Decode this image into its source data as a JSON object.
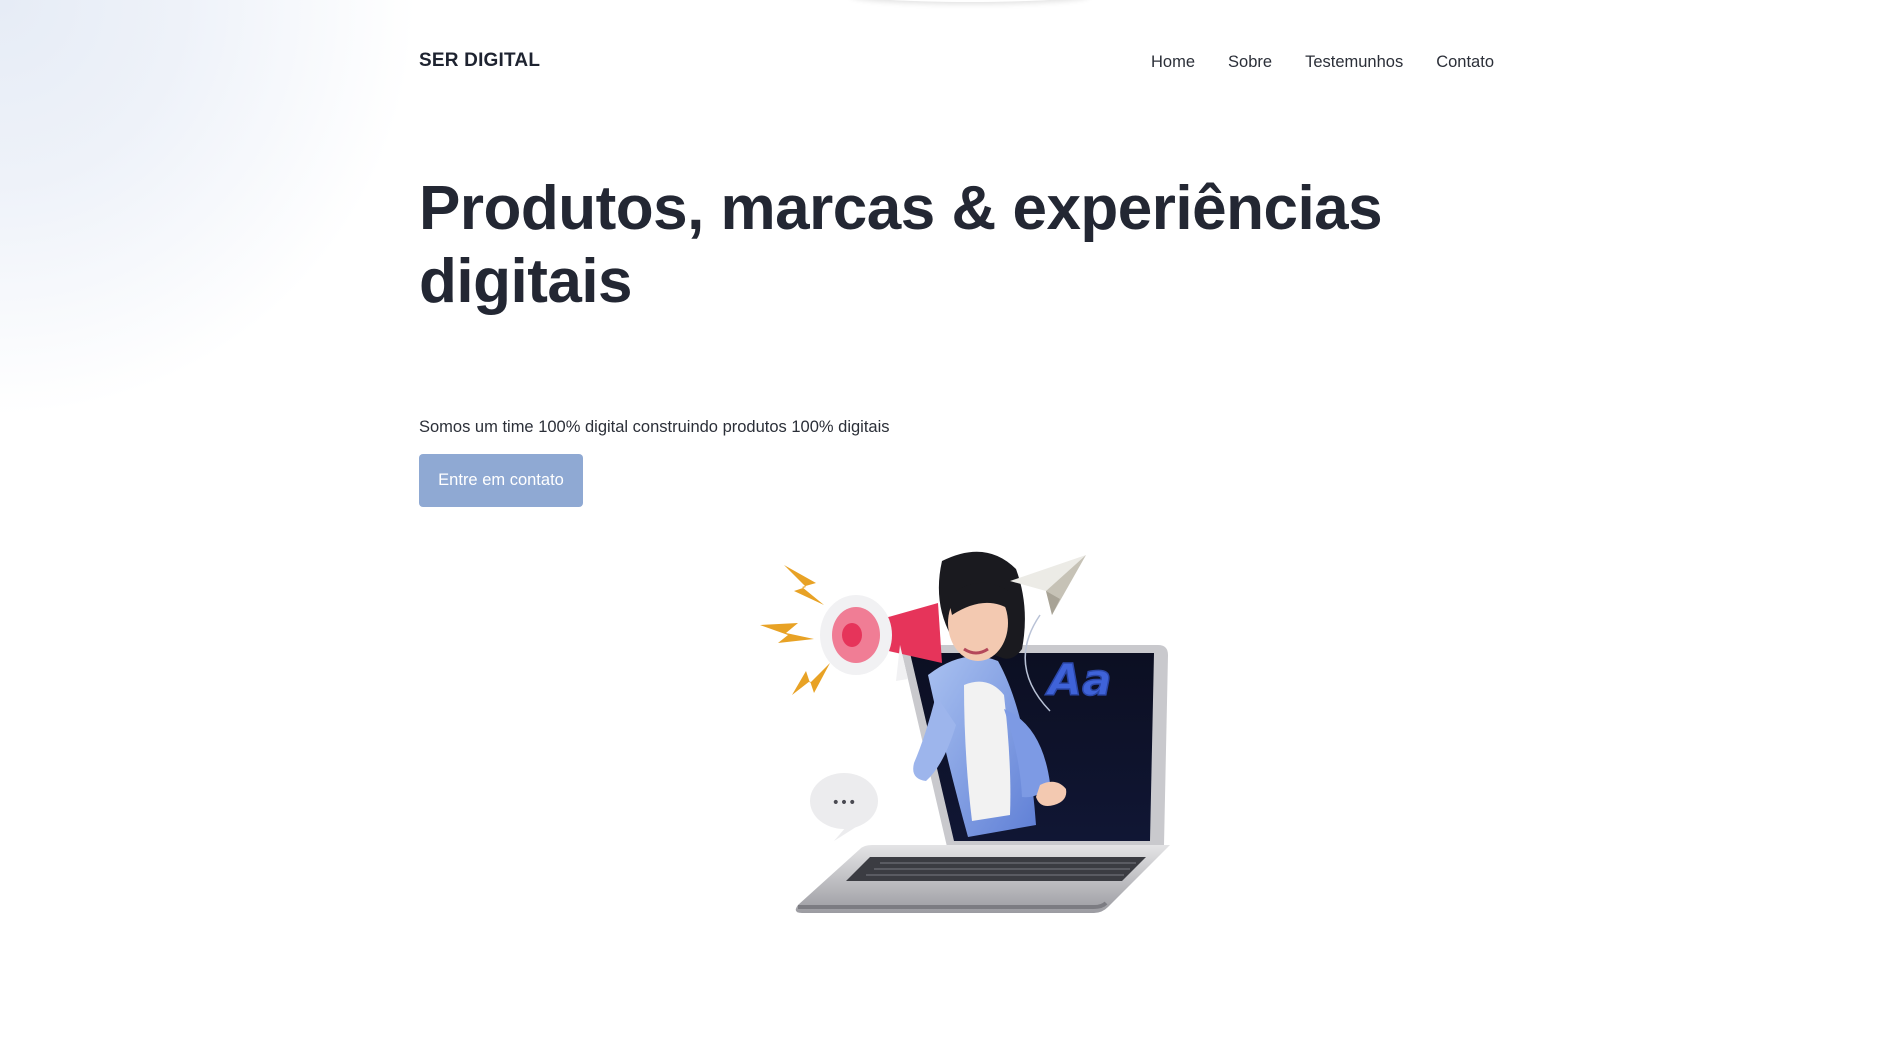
{
  "header": {
    "logo": "SER DIGITAL",
    "nav": [
      "Home",
      "Sobre",
      "Testemunhos",
      "Contato"
    ]
  },
  "hero": {
    "title_line1": "Produtos, marcas & experiências",
    "title_line2": "digitais",
    "subtitle": "Somos um time 100% digital construindo produtos 100% digitais",
    "cta_label": "Entre em contato"
  },
  "illustration": {
    "icons": [
      "megaphone-icon",
      "paper-plane-icon",
      "chat-bubble-icon",
      "lightning-icon",
      "font-aa-icon",
      "laptop-icon"
    ],
    "aa_text": "Aa",
    "bubble_text": "•••"
  },
  "colors": {
    "text": "#232733",
    "cta_bg": "#8fa9d3",
    "background": "#ffffff"
  }
}
